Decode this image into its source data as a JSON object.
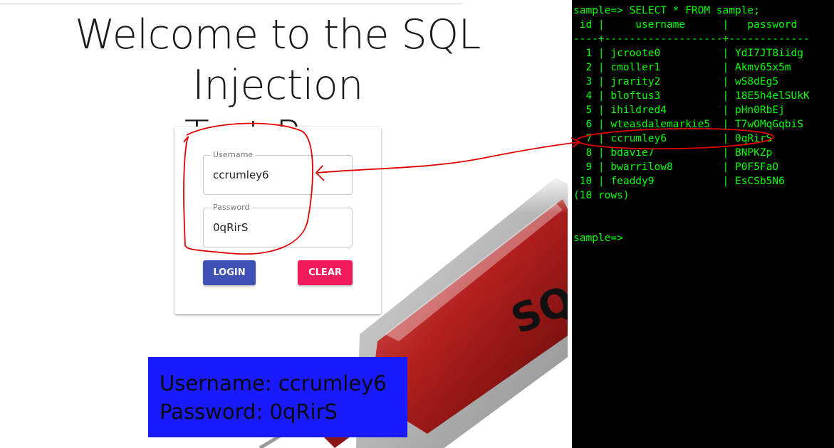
{
  "page": {
    "title_line1": "Welcome to the SQL Injection",
    "title_line2": "Test Page",
    "syringe_text": "SQ"
  },
  "login_form": {
    "username_label": "Username",
    "username_value": "ccrumley6",
    "password_label": "Password",
    "password_value": "0qRirS",
    "login_label": "LOGIN",
    "clear_label": "CLEAR"
  },
  "credentials_overlay": {
    "username_line": "Username: ccrumley6",
    "password_line": "Password: 0qRirS"
  },
  "terminal": {
    "command": "sample=> SELECT * FROM sample;",
    "header": " id |     username      |   password",
    "separator": "----+-------------------+-------------",
    "rows": [
      "  1 | jcroote0          | YdI7JT8iidg",
      "  2 | cmoller1          | Akmv65x5m",
      "  3 | jrarity2          | wS8dEg5",
      "  4 | bloftus3          | 18E5h4elSUkK",
      "  5 | ihildred4         | pHn0RbEj",
      "  6 | wteasdalemarkie5  | T7wOMqGqbiS",
      "  7 | ccrumley6         | 0qRirS",
      "  8 | bdavie7           | BNPKZp",
      "  9 | bwarrilow8        | P0F5FaO",
      " 10 | feaddy9           | EsCSb5N6"
    ],
    "row_count": "(10 rows)",
    "prompt": "sample=>"
  },
  "colors": {
    "terminal_text": "#00ff00",
    "login_button": "#3f51b5",
    "clear_button": "#f01a5c",
    "overlay_background": "#1a1aff",
    "annotation": "#e00000"
  }
}
